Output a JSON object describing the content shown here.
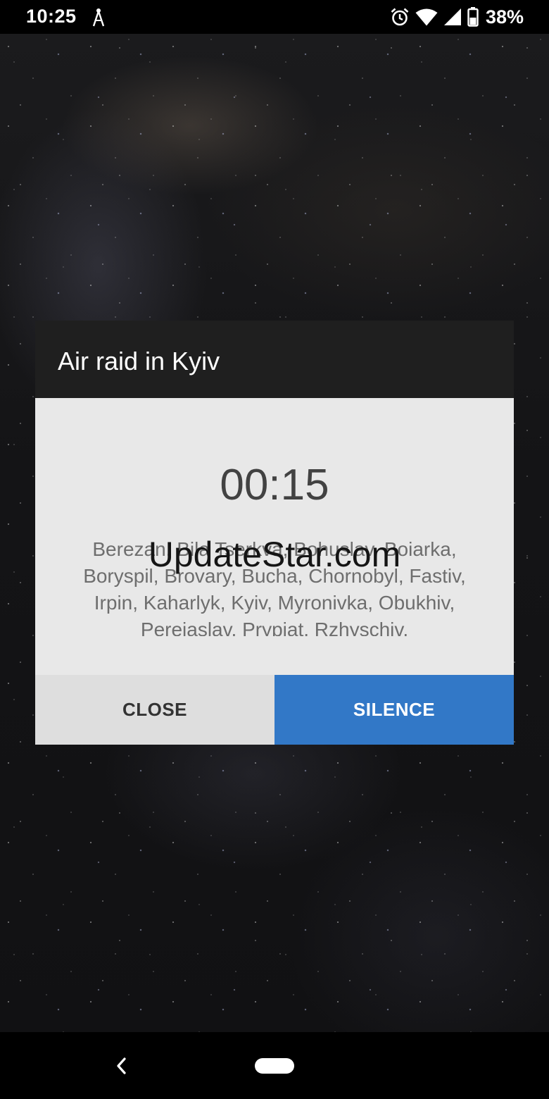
{
  "status_bar": {
    "time": "10:25",
    "battery_percent": "38%",
    "icons": [
      "antenna-icon",
      "alarm-icon",
      "wifi-icon",
      "cell-signal-icon",
      "battery-icon"
    ]
  },
  "dialog": {
    "title": "Air raid in Kyiv",
    "timer": "00:15",
    "regions": "Berezan, Bila Tserkva, Bohuslav, Boiarka, Boryspil, Brovary, Bucha, Chornobyl, Fastiv, Irpin, Kaharlyk, Kyiv, Myronivka, Obukhiv, Pereiaslav, Prypiat, Rzhyschiv,",
    "close_label": "CLOSE",
    "silence_label": "SILENCE"
  },
  "watermark": "UpdateStar.com",
  "nav_bar": {
    "icons": [
      "back-icon",
      "home-pill-icon"
    ]
  },
  "colors": {
    "dialog_header": "#1f1f1f",
    "dialog_body": "#e8e8e8",
    "close_button": "#dedede",
    "silence_button": "#3278c7"
  }
}
